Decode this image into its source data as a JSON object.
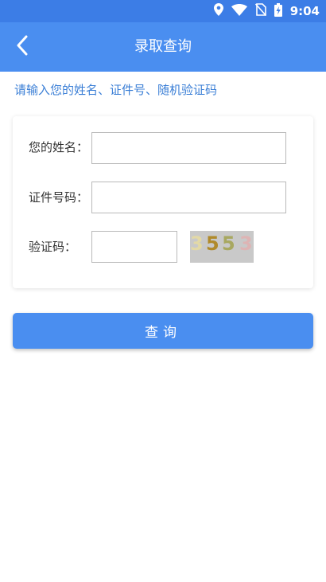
{
  "status_bar": {
    "time": "9:04",
    "icons": [
      "location-icon",
      "wifi-icon",
      "no-sim-icon",
      "battery-charging-icon"
    ]
  },
  "app_bar": {
    "title": "录取查询",
    "back_icon": "chevron-left-icon"
  },
  "hint": "请输入您的姓名、证件号、随机验证码",
  "form": {
    "name_label": "您的姓名：",
    "name_value": "",
    "id_label": "证件号码：",
    "id_value": "",
    "captcha_label": "验证码：",
    "captcha_value": "",
    "captcha_image_text": "3553"
  },
  "query_button": "查询",
  "colors": {
    "status_bar": "#3c7de6",
    "app_bar": "#4a8ef0",
    "hint_text": "#3b7fd6",
    "button": "#4a8ef0",
    "captcha_bg": "#c9c9c9"
  }
}
